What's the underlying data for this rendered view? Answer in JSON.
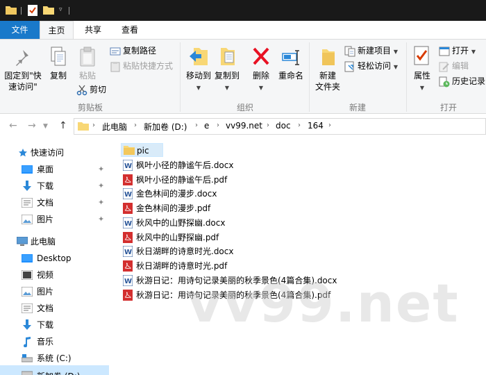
{
  "window": {
    "quick_access_toolbar": [
      "folder-icon",
      "properties-check-icon",
      "new-folder-icon",
      "customize-dropdown-icon"
    ]
  },
  "tabs": [
    {
      "label": "文件"
    },
    {
      "label": "主页"
    },
    {
      "label": "共享"
    },
    {
      "label": "查看"
    }
  ],
  "ribbon": {
    "clipboard": {
      "pin_quick_access": "固定到\"快速访问\"",
      "copy": "复制",
      "paste": "粘贴",
      "copy_path": "复制路径",
      "paste_shortcut": "粘贴快捷方式",
      "cut": "剪切",
      "group_label": "剪贴板"
    },
    "organize": {
      "move_to": "移动到",
      "copy_to": "复制到",
      "delete": "删除",
      "rename": "重命名",
      "group_label": "组织"
    },
    "new": {
      "new_folder": "新建\n文件夹",
      "new_folder_line1": "新建",
      "new_folder_line2": "文件夹",
      "new_item": "新建项目",
      "easy_access": "轻松访问",
      "group_label": "新建"
    },
    "open": {
      "properties": "属性",
      "open": "打开",
      "edit": "编辑",
      "history": "历史记录",
      "group_label": "打开"
    }
  },
  "address": {
    "back": "←",
    "forward": "→",
    "up": "↑",
    "crumbs": [
      "此电脑",
      "新加卷 (D:)",
      "e",
      "vv99.net",
      "doc",
      "164"
    ]
  },
  "nav": {
    "quick_access": "快速访问",
    "quick_items": [
      "桌面",
      "下载",
      "文档",
      "图片"
    ],
    "this_pc": "此电脑",
    "pc_items": [
      "Desktop",
      "视频",
      "图片",
      "文档",
      "下载",
      "音乐",
      "系统 (C:)",
      "新加卷 (D:)"
    ]
  },
  "files": [
    {
      "name": "pic",
      "type": "folder"
    },
    {
      "name": "枫叶小径的静谧午后.docx",
      "type": "docx"
    },
    {
      "name": "枫叶小径的静谧午后.pdf",
      "type": "pdf"
    },
    {
      "name": "金色林间的漫步.docx",
      "type": "docx"
    },
    {
      "name": "金色林间的漫步.pdf",
      "type": "pdf"
    },
    {
      "name": "秋风中的山野探幽.docx",
      "type": "docx"
    },
    {
      "name": "秋风中的山野探幽.pdf",
      "type": "pdf"
    },
    {
      "name": "秋日湖畔的诗意时光.docx",
      "type": "docx"
    },
    {
      "name": "秋日湖畔的诗意时光.pdf",
      "type": "pdf"
    },
    {
      "name": "秋游日记：用诗句记录美丽的秋季景色(4篇合集).docx",
      "type": "docx"
    },
    {
      "name": "秋游日记：用诗句记录美丽的秋季景色(4篇合集).pdf",
      "type": "pdf"
    }
  ],
  "watermark": "vv99.net",
  "colors": {
    "accent": "#1979ca",
    "selection": "#cce8ff",
    "titlebar": "#191919",
    "ribbon_bg": "#f5f6f7",
    "pdf_red": "#d32f2f",
    "docx_blue": "#2b579a",
    "folder_yellow": "#f8d775"
  }
}
